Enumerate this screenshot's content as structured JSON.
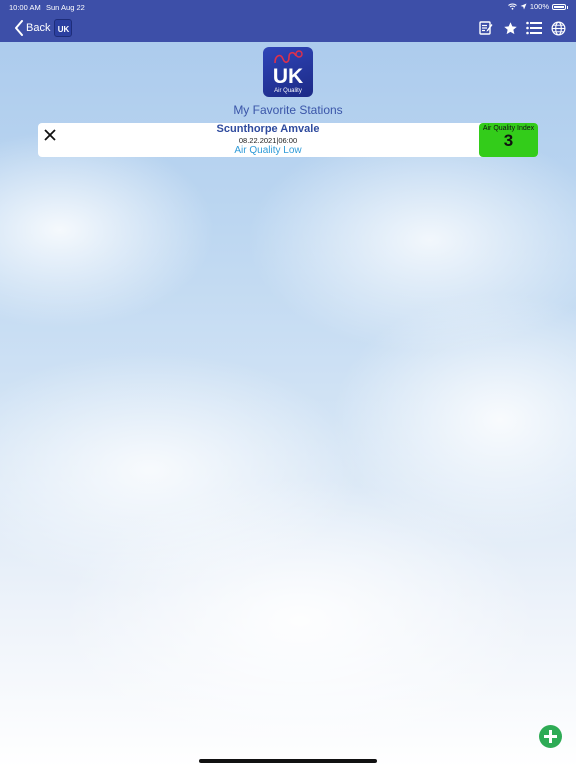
{
  "status_bar": {
    "time": "10:00 AM",
    "date": "Sun Aug 22",
    "battery": "100%"
  },
  "nav": {
    "back_label": "Back",
    "mini_logo_text": "UK",
    "icons": [
      "notes-icon",
      "star-icon",
      "list-icon",
      "globe-icon"
    ],
    "bar_color": "#3d4fa8"
  },
  "logo": {
    "main": "UK",
    "sub": "Air Quality"
  },
  "page_title": "My Favorite Stations",
  "stations": [
    {
      "name": "Scunthorpe Amvale",
      "timestamp": "08.22.2021|06:00",
      "quality": "Air Quality Low",
      "aqi_label": "Air Quality Index",
      "aqi_value": "3",
      "aqi_color": "#33cc1a"
    }
  ],
  "add_button_color": "#2eab55"
}
